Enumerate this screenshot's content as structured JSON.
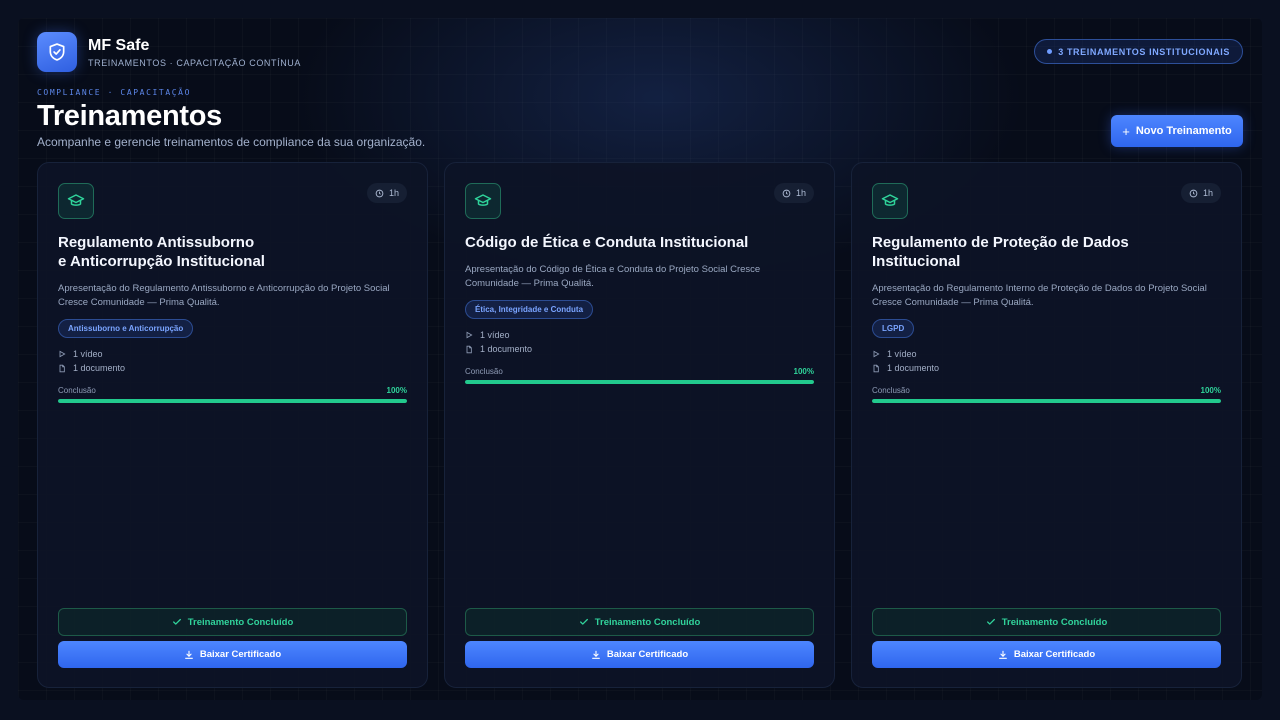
{
  "brand": {
    "name": "MF Safe",
    "subtitle": "TREINAMENTOS · CAPACITAÇÃO CONTÍNUA",
    "icon": "shield-check-icon"
  },
  "count_badge": "3 TREINAMENTOS INSTITUCIONAIS",
  "eyebrow": "COMPLIANCE · CAPACITAÇÃO",
  "page_title": "Treinamentos",
  "page_description": "Acompanhe e gerencie treinamentos de compliance da sua organização.",
  "new_button": {
    "icon": "+",
    "label": "Novo Treinamento"
  },
  "colors": {
    "accent": "#3b74f6",
    "success": "#22c98d",
    "background": "#070c19"
  },
  "cards": [
    {
      "duration": "1h",
      "title_line1": "Regulamento Antissuborno",
      "title_line2": "e Anticorrupção Institucional",
      "description": "Apresentação do Regulamento Antissuborno e Anticorrupção do Projeto Social Cresce Comunidade — Prima Qualitá.",
      "tag": "Antissuborno e Anticorrupção",
      "videos": "1 vídeo",
      "documents": "1 documento",
      "progress_label": "Conclusão",
      "progress_text": "100%",
      "progress": 1.0,
      "done_label": "Treinamento Concluído",
      "cert_label": "Baixar Certificado"
    },
    {
      "duration": "1h",
      "title_line1": "Código de Ética e Conduta Institucional",
      "title_line2": "",
      "description": "Apresentação do Código de Ética e Conduta do Projeto Social Cresce Comunidade — Prima Qualitá.",
      "tag": "Ética, Integridade e Conduta",
      "videos": "1 vídeo",
      "documents": "1 documento",
      "progress_label": "Conclusão",
      "progress_text": "100%",
      "progress": 1.0,
      "done_label": "Treinamento Concluído",
      "cert_label": "Baixar Certificado"
    },
    {
      "duration": "1h",
      "title_line1": "Regulamento de Proteção de Dados Institucional",
      "title_line2": "",
      "description": "Apresentação do Regulamento Interno de Proteção de Dados do Projeto Social Cresce Comunidade — Prima Qualitá.",
      "tag": "LGPD",
      "videos": "1 vídeo",
      "documents": "1 documento",
      "progress_label": "Conclusão",
      "progress_text": "100%",
      "progress": 1.0,
      "done_label": "Treinamento Concluído",
      "cert_label": "Baixar Certificado"
    }
  ]
}
